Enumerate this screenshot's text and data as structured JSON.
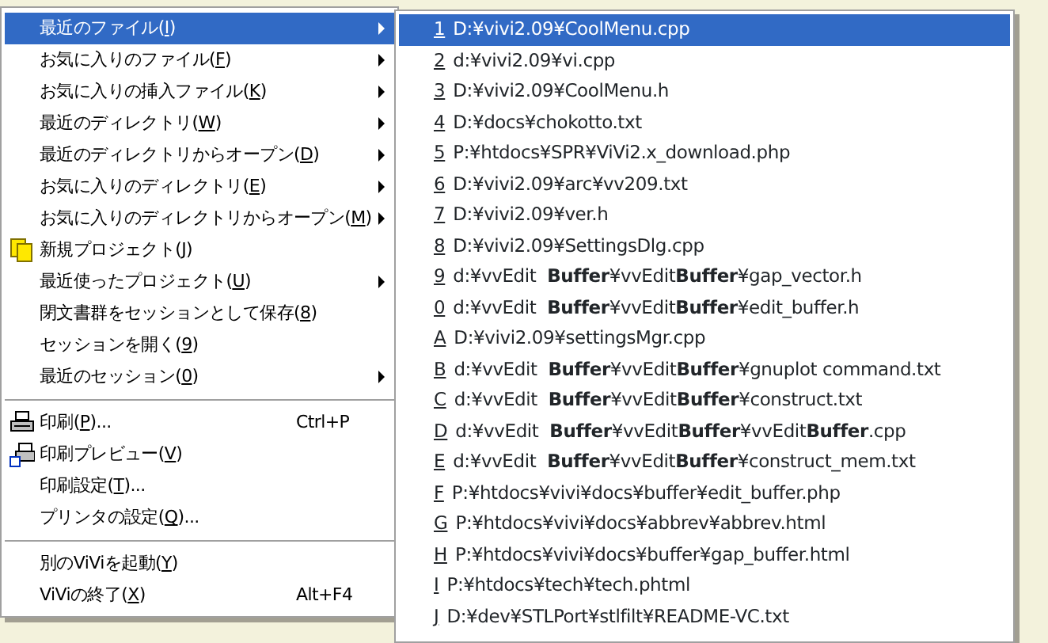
{
  "main_menu": {
    "items": [
      {
        "kind": "item",
        "label": "最近のファイル(I)",
        "submenu": true,
        "selected": true
      },
      {
        "kind": "item",
        "label": "お気に入りのファイル(F)",
        "submenu": true,
        "selected": false
      },
      {
        "kind": "item",
        "label": "お気に入りの挿入ファイル(K)",
        "submenu": true,
        "selected": false
      },
      {
        "kind": "item",
        "label": "最近のディレクトリ(W)",
        "submenu": true,
        "selected": false
      },
      {
        "kind": "item",
        "label": "最近のディレクトリからオープン(D)",
        "submenu": true,
        "selected": false
      },
      {
        "kind": "item",
        "label": "お気に入りのディレクトリ(E)",
        "submenu": true,
        "selected": false
      },
      {
        "kind": "item",
        "label": "お気に入りのディレクトリからオープン(M)",
        "submenu": true,
        "selected": false
      },
      {
        "kind": "project",
        "label": "新規プロジェクト(J)",
        "submenu": false,
        "selected": false
      },
      {
        "kind": "item",
        "label": "最近使ったプロジェクト(U)",
        "submenu": true,
        "selected": false
      },
      {
        "kind": "item",
        "label": "閉文書群をセッションとして保存(8)",
        "submenu": false,
        "selected": false
      },
      {
        "kind": "item",
        "label": "セッションを開く(9)",
        "submenu": false,
        "selected": false
      },
      {
        "kind": "item",
        "label": "最近のセッション(0)",
        "submenu": true,
        "selected": false
      },
      {
        "kind": "separator"
      },
      {
        "kind": "print",
        "label": "印刷(P)...",
        "shortcut": "Ctrl+P",
        "submenu": false,
        "selected": false
      },
      {
        "kind": "preview",
        "label": "印刷プレビュー(V)",
        "submenu": false,
        "selected": false
      },
      {
        "kind": "item",
        "label": "印刷設定(T)...",
        "submenu": false,
        "selected": false
      },
      {
        "kind": "item",
        "label": "プリンタの設定(Q)...",
        "submenu": false,
        "selected": false
      },
      {
        "kind": "separator"
      },
      {
        "kind": "item",
        "label": "別のViViを起動(Y)",
        "submenu": false,
        "selected": false
      },
      {
        "kind": "item",
        "label": "ViViの終了(X)",
        "shortcut": "Alt+F4",
        "submenu": false,
        "selected": false
      }
    ]
  },
  "recent_files": {
    "items": [
      {
        "key": "1",
        "path": "D:¥vivi2.09¥CoolMenu.cpp",
        "selected": true
      },
      {
        "key": "2",
        "path": "d:¥vivi2.09¥vi.cpp",
        "selected": false
      },
      {
        "key": "3",
        "path": "D:¥vivi2.09¥CoolMenu.h",
        "selected": false
      },
      {
        "key": "4",
        "path": "D:¥docs¥chokotto.txt",
        "selected": false
      },
      {
        "key": "5",
        "path": "P:¥htdocs¥SPR¥ViVi2.x_download.php",
        "selected": false
      },
      {
        "key": "6",
        "path": "D:¥vivi2.09¥arc¥vv209.txt",
        "selected": false
      },
      {
        "key": "7",
        "path": "D:¥vivi2.09¥ver.h",
        "selected": false
      },
      {
        "key": "8",
        "path": "D:¥vivi2.09¥SettingsDlg.cpp",
        "selected": false
      },
      {
        "key": "9",
        "path": "d:¥vvEdit  **Buffer**¥vvEdit**Buffer**¥gap_vector.h",
        "selected": false
      },
      {
        "key": "0",
        "path": "d:¥vvEdit  **Buffer**¥vvEdit**Buffer**¥edit_buffer.h",
        "selected": false
      },
      {
        "key": "A",
        "path": "D:¥vivi2.09¥settingsMgr.cpp",
        "selected": false
      },
      {
        "key": "B",
        "path": "d:¥vvEdit  **Buffer**¥vvEdit**Buffer**¥gnuplot command.txt",
        "selected": false
      },
      {
        "key": "C",
        "path": "d:¥vvEdit  **Buffer**¥vvEdit**Buffer**¥construct.txt",
        "selected": false
      },
      {
        "key": "D",
        "path": "d:¥vvEdit  **Buffer**¥vvEdit**Buffer**¥vvEdit**Buffer**.cpp",
        "selected": false
      },
      {
        "key": "E",
        "path": "d:¥vvEdit  **Buffer**¥vvEdit**Buffer**¥construct_mem.txt",
        "selected": false
      },
      {
        "key": "F",
        "path": "P:¥htdocs¥vivi¥docs¥buffer¥edit_buffer.php",
        "selected": false
      },
      {
        "key": "G",
        "path": "P:¥htdocs¥vivi¥docs¥abbrev¥abbrev.html",
        "selected": false
      },
      {
        "key": "H",
        "path": "P:¥htdocs¥vivi¥docs¥buffer¥gap_buffer.html",
        "selected": false
      },
      {
        "key": "I",
        "path": "P:¥htdocs¥tech¥tech.phtml",
        "selected": false
      },
      {
        "key": "J",
        "path": "D:¥dev¥STLPort¥stlfilt¥README-VC.txt",
        "selected": false
      }
    ]
  }
}
